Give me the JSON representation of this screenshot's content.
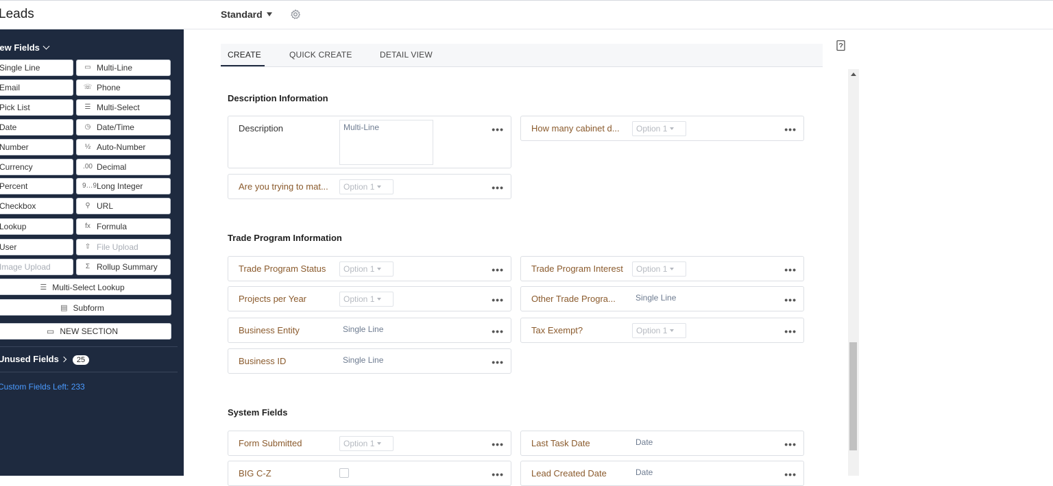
{
  "header": {
    "module_title": "Leads",
    "layout_name": "Standard"
  },
  "sidebar": {
    "new_fields_label": "New Fields",
    "field_types": [
      {
        "label": "Single Line",
        "icon": "single-line-icon"
      },
      {
        "label": "Multi-Line",
        "icon": "multi-line-icon"
      },
      {
        "label": "Email",
        "icon": "email-icon"
      },
      {
        "label": "Phone",
        "icon": "phone-icon"
      },
      {
        "label": "Pick List",
        "icon": "picklist-icon"
      },
      {
        "label": "Multi-Select",
        "icon": "multi-select-icon"
      },
      {
        "label": "Date",
        "icon": "date-icon"
      },
      {
        "label": "Date/Time",
        "icon": "datetime-icon"
      },
      {
        "label": "Number",
        "icon": "number-icon"
      },
      {
        "label": "Auto-Number",
        "icon": "auto-number-icon"
      },
      {
        "label": "Currency",
        "icon": "currency-icon"
      },
      {
        "label": "Decimal",
        "icon": "decimal-icon",
        "glyph": ".00"
      },
      {
        "label": "Percent",
        "icon": "percent-icon"
      },
      {
        "label": "Long Integer",
        "icon": "long-integer-icon",
        "glyph": "9…9"
      },
      {
        "label": "Checkbox",
        "icon": "checkbox-icon"
      },
      {
        "label": "URL",
        "icon": "url-icon"
      },
      {
        "label": "Lookup",
        "icon": "lookup-icon"
      },
      {
        "label": "Formula",
        "icon": "formula-icon",
        "glyph": "fx"
      },
      {
        "label": "User",
        "icon": "user-icon"
      },
      {
        "label": "File Upload",
        "icon": "file-upload-icon",
        "disabled": true
      },
      {
        "label": "Image Upload",
        "icon": "image-upload-icon",
        "disabled": true
      },
      {
        "label": "Rollup Summary",
        "icon": "rollup-summary-icon"
      }
    ],
    "multi_select_lookup": "Multi-Select Lookup",
    "subform": "Subform",
    "new_section": "NEW SECTION",
    "used_fields_label": "Unused Fields",
    "used_fields_count": "25",
    "custom_fields_left": "Custom Fields Left: 233"
  },
  "tabs": [
    "CREATE",
    "QUICK CREATE",
    "DETAIL VIEW"
  ],
  "sections": [
    {
      "title": "Description Information",
      "fields": [
        {
          "label": "Description",
          "kind": "multiline",
          "placeholder": "Multi-Line",
          "dark": true
        },
        {
          "label": "How many cabinet d...",
          "kind": "picklist",
          "placeholder": "Option 1"
        },
        {
          "label": "Are you trying to mat...",
          "kind": "picklist",
          "placeholder": "Option 1"
        }
      ]
    },
    {
      "title": "Trade Program Information",
      "fields": [
        {
          "label": "Trade Program Status",
          "kind": "picklist",
          "placeholder": "Option 1"
        },
        {
          "label": "Trade Program Interest",
          "kind": "picklist",
          "placeholder": "Option 1"
        },
        {
          "label": "Projects per Year",
          "kind": "picklist",
          "placeholder": "Option 1"
        },
        {
          "label": "Other Trade Progra...",
          "kind": "text",
          "placeholder": "Single Line"
        },
        {
          "label": "Business Entity",
          "kind": "text",
          "placeholder": "Single Line"
        },
        {
          "label": "Tax Exempt?",
          "kind": "picklist",
          "placeholder": "Option 1"
        },
        {
          "label": "Business ID",
          "kind": "text",
          "placeholder": "Single Line"
        }
      ]
    },
    {
      "title": "System Fields",
      "fields": [
        {
          "label": "Form Submitted",
          "kind": "picklist",
          "placeholder": "Option 1"
        },
        {
          "label": "Last Task Date",
          "kind": "text",
          "placeholder": "Date"
        },
        {
          "label": "BIG C-Z",
          "kind": "checkbox"
        },
        {
          "label": "Lead Created Date",
          "kind": "text",
          "placeholder": "Date"
        }
      ]
    }
  ],
  "field_menu_glyph": "•••"
}
